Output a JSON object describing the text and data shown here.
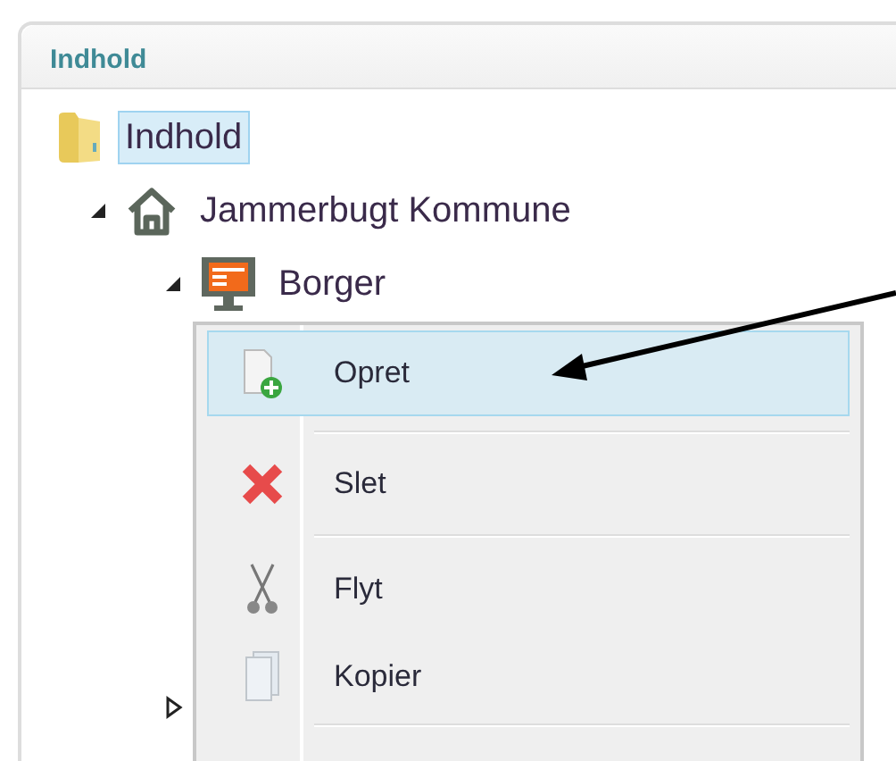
{
  "panel": {
    "title": "Indhold"
  },
  "tree": [
    {
      "label": "Indhold",
      "kind": "folder",
      "selected": true,
      "children": [
        {
          "label": "Jammerbugt Kommune",
          "kind": "home",
          "selected": false,
          "expanded": true,
          "children": [
            {
              "label": "Borger",
              "kind": "page",
              "selected": false,
              "expanded": true
            },
            {
              "expanded": false
            }
          ]
        }
      ]
    }
  ],
  "context_menu": [
    {
      "label": "Opret",
      "kind": "add",
      "selected": true,
      "separator_after": true
    },
    {
      "label": "Slet",
      "kind": "delete",
      "selected": false,
      "separator_after": true
    },
    {
      "label": "Flyt",
      "kind": "cut",
      "selected": false,
      "separator_after": false
    },
    {
      "label": "Kopier",
      "kind": "copy",
      "selected": false,
      "separator_after": true
    }
  ]
}
